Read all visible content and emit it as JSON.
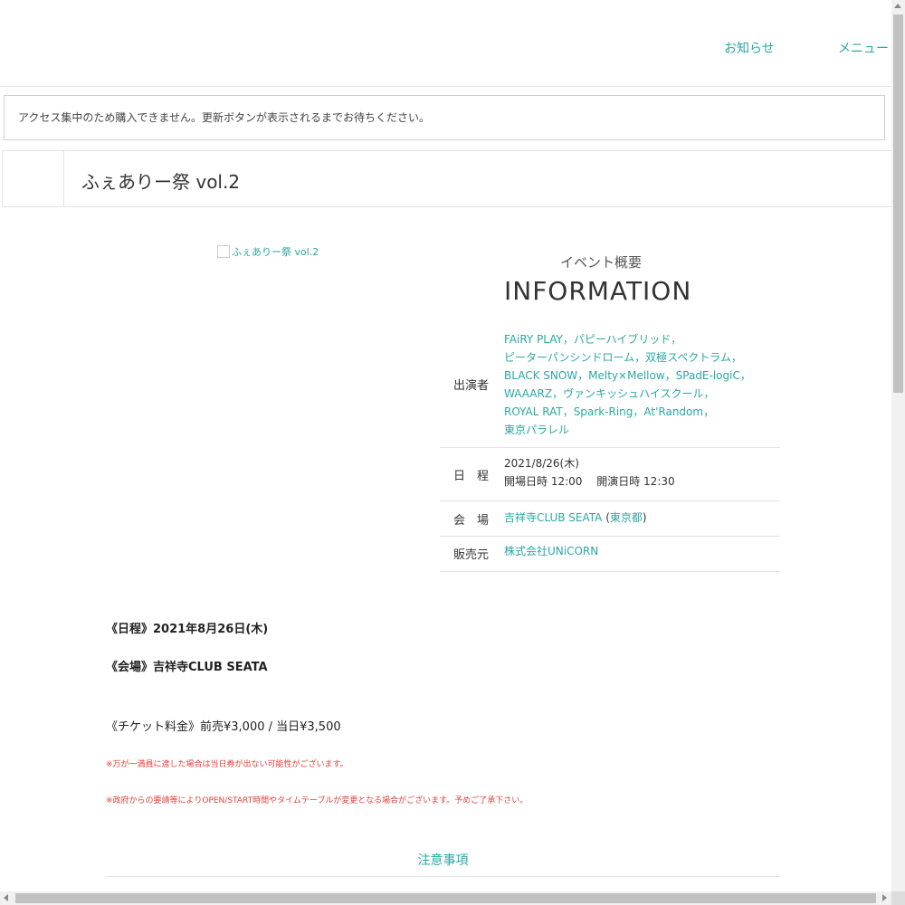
{
  "header": {
    "nav": [
      "お知らせ",
      "メニュー"
    ]
  },
  "notice": {
    "text": "アクセス集中のため購入できません。更新ボタンが表示されるまでお待ちください。"
  },
  "event": {
    "title": "ふぇありー祭 vol.2",
    "image_alt": "ふぇありー祭 vol.2"
  },
  "info": {
    "subheading": "イベント概要",
    "heading": "INFORMATION",
    "performers_label": "出演者",
    "performers_lines": [
      "FAiRY PLAY，パピーハイブリッド，",
      "ピーターパンシンドローム，双極スペクトラム，",
      "BLACK SNOW，Melty×Mellow，SPadE-logiC，",
      "WAAARZ，ヴァンキッシュハイスクール，",
      "ROYAL RAT，Spark-Ring，At'Random，",
      "東京パラレル"
    ],
    "schedule_label": "日　程",
    "schedule_date": "2021/8/26(木)",
    "schedule_times": "開場日時 12:00　 開演日時 12:30",
    "venue_label": "会　場",
    "venue_name": "吉祥寺CLUB SEATA",
    "venue_region": "東京都",
    "seller_label": "販売元",
    "seller_name": "株式会社UNiCORN"
  },
  "details": {
    "date_line": "《日程》2021年8月26日(木)",
    "venue_line": "《会場》吉祥寺CLUB SEATA",
    "price_line": "《チケット料金》前売¥3,000 / 当日¥3,500",
    "note1": "※万が一満員に達した場合は当日券が出ない可能性がございます。",
    "note2": "※政府からの要請等によりOPEN/START時間やタイムテーブルが変更となる場合がございます。予めご了承下さい。",
    "caution_heading": "注意事項"
  },
  "colors": {
    "accent": "#2aa8a3",
    "warning": "#e2413b"
  }
}
